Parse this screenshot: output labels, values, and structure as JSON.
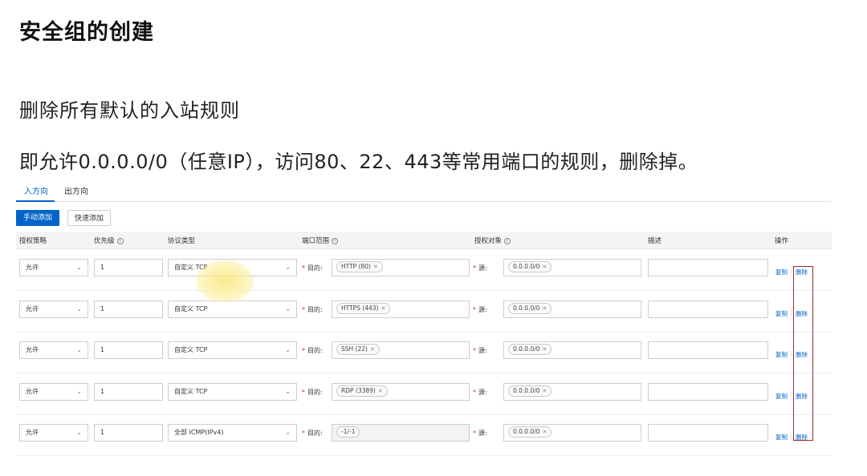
{
  "slide": {
    "title": "安全组的创建",
    "subtitle": "删除所有默认的入站规则",
    "description": "即允许0.0.0.0/0（任意IP），访问80、22、443等常用端口的规则，删除掉。"
  },
  "tabs": [
    {
      "label": "入方向",
      "active": true
    },
    {
      "label": "出方向",
      "active": false
    }
  ],
  "toolbar": {
    "manual_add_label": "手动添加",
    "quick_add_label": "快速添加"
  },
  "table": {
    "headers": {
      "policy": "授权策略",
      "priority": "优先级",
      "protocol": "协议类型",
      "port_range": "端口范围",
      "source": "授权对象",
      "description": "描述",
      "actions": "操作"
    },
    "dest_label": "目的:",
    "source_label": "源:",
    "copy_label": "复制",
    "delete_label": "删除",
    "rows": [
      {
        "policy": "允许",
        "priority": "1",
        "protocol": "自定义 TCP",
        "port": "HTTP (80)",
        "source": "0.0.0.0/0",
        "description": ""
      },
      {
        "policy": "允许",
        "priority": "1",
        "protocol": "自定义 TCP",
        "port": "HTTPS (443)",
        "source": "0.0.0.0/0",
        "description": ""
      },
      {
        "policy": "允许",
        "priority": "1",
        "protocol": "自定义 TCP",
        "port": "SSH (22)",
        "source": "0.0.0.0/0",
        "description": ""
      },
      {
        "policy": "允许",
        "priority": "1",
        "protocol": "自定义 TCP",
        "port": "RDP (3389)",
        "source": "0.0.0.0/0",
        "description": ""
      },
      {
        "policy": "允许",
        "priority": "1",
        "protocol": "全部 ICMP(IPv4)",
        "port": "-1/-1",
        "source": "0.0.0.0/0",
        "description": ""
      }
    ]
  },
  "colors": {
    "accent": "#0064c8",
    "highlight_box": "#a0262a",
    "required_mark": "#d93026"
  }
}
